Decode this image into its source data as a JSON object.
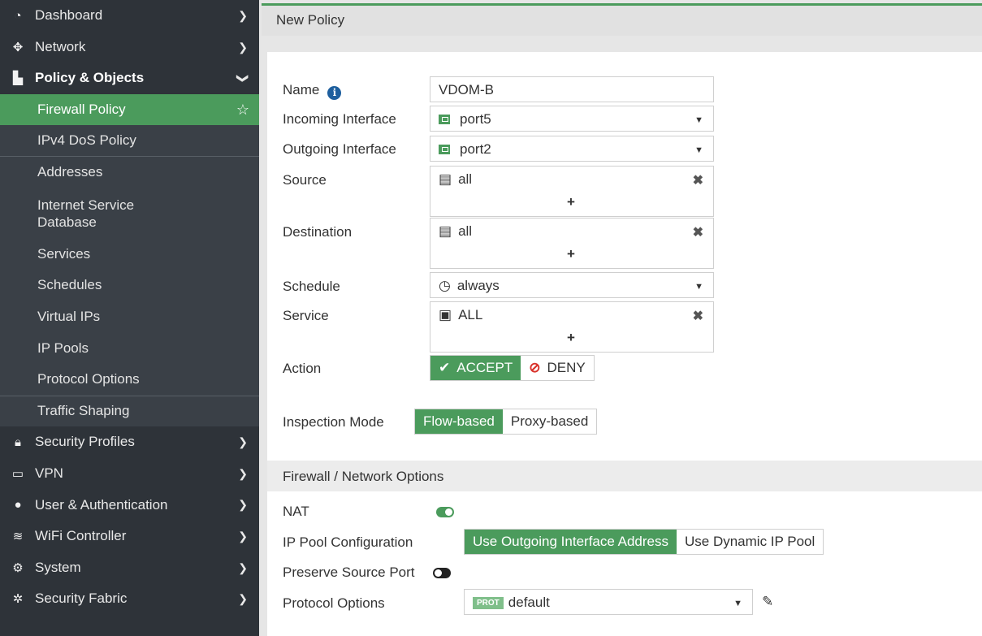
{
  "sidebar": {
    "dashboard": "Dashboard",
    "network": "Network",
    "policy_objects": "Policy & Objects",
    "firewall_policy": "Firewall Policy",
    "ipv4_dos_policy": "IPv4 DoS Policy",
    "addresses": "Addresses",
    "internet_service_db_line1": "Internet Service",
    "internet_service_db_line2": "Database",
    "services": "Services",
    "schedules": "Schedules",
    "virtual_ips": "Virtual IPs",
    "ip_pools": "IP Pools",
    "protocol_options": "Protocol Options",
    "traffic_shaping": "Traffic Shaping",
    "security_profiles": "Security Profiles",
    "vpn": "VPN",
    "user_auth": "User & Authentication",
    "wifi_controller": "WiFi Controller",
    "system": "System",
    "security_fabric": "Security Fabric"
  },
  "page": {
    "title": "New Policy"
  },
  "form": {
    "name_label": "Name",
    "name_value": "VDOM-B",
    "incoming_label": "Incoming Interface",
    "incoming_value": "port5",
    "outgoing_label": "Outgoing Interface",
    "outgoing_value": "port2",
    "source_label": "Source",
    "source_value": "all",
    "destination_label": "Destination",
    "destination_value": "all",
    "schedule_label": "Schedule",
    "schedule_value": "always",
    "service_label": "Service",
    "service_value": "ALL",
    "action_label": "Action",
    "accept_label": "ACCEPT",
    "deny_label": "DENY",
    "inspection_label": "Inspection Mode",
    "flow_label": "Flow-based",
    "proxy_label": "Proxy-based"
  },
  "network_options": {
    "header": "Firewall / Network Options",
    "nat_label": "NAT",
    "nat_enabled": true,
    "ip_pool_label": "IP Pool Configuration",
    "use_outgoing_label": "Use Outgoing Interface Address",
    "use_dynamic_label": "Use Dynamic IP Pool",
    "preserve_port_label": "Preserve Source Port",
    "preserve_port_enabled": false,
    "protocol_options_label": "Protocol Options",
    "prot_badge": "PROT",
    "protocol_options_value": "default"
  },
  "colors": {
    "accent": "#4b9b5c",
    "sidebar": "#2e3339",
    "deny": "#d9322b"
  }
}
